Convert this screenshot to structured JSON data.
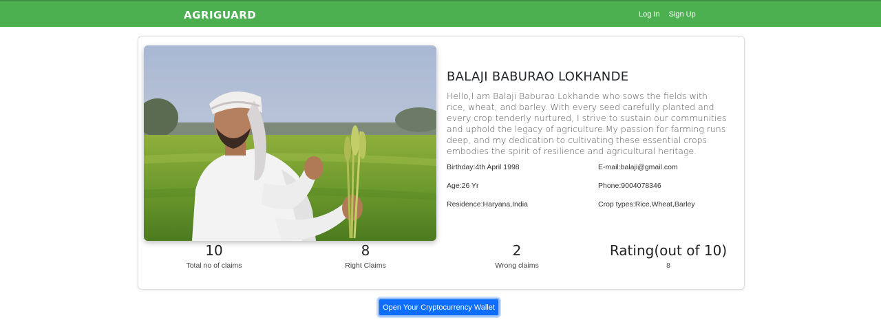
{
  "navbar": {
    "brand": "AGRIGUARD",
    "links": [
      "Log In",
      "Sign Up"
    ]
  },
  "profile": {
    "name": "BALAJI BABURAO LOKHANDE",
    "bio": "Hello,I am Balaji Baburao Lokhande who sows the fields with rice, wheat, and barley. With every seed carefully planted and every crop tenderly nurtured, I strive to sustain our communities and uphold the legacy of agriculture.My passion for farming runs deep, and my dedication to cultivating these essential crops embodies the spirit of resilience and agricultural heritage.",
    "birthday": "Birthday:4th April 1998",
    "email": "E-mail:balaji@gmail.com",
    "age": "Age:26 Yr",
    "phone": "Phone:9004078346",
    "residence": "Residence:Haryana,India",
    "crop_types": "Crop types:Rice,Wheat,Barley"
  },
  "stats": [
    {
      "value": "10",
      "label": "Total no of claims"
    },
    {
      "value": "8",
      "label": "Right Claims"
    },
    {
      "value": "2",
      "label": "Wrong claims"
    },
    {
      "value": "Rating(out of 10)",
      "label": "8"
    }
  ],
  "wallet_button": "Open Your Cryptocurrency Wallet",
  "colors": {
    "navbar": "#4caf50",
    "button": "#0d6efd"
  }
}
